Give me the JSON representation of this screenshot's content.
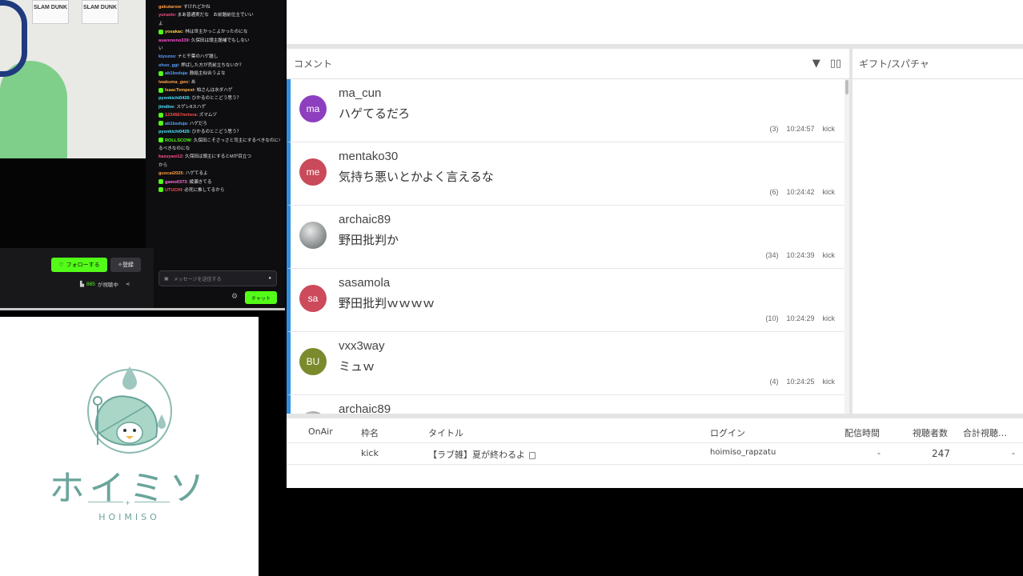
{
  "stream_capture": {
    "posters": [
      "SLAM DUNK",
      "SLAM DUNK"
    ],
    "kick_chat": [
      {
        "user": "gakutarow",
        "text": "すけれどかね",
        "color": "#ff9f43",
        "badge": false
      },
      {
        "user": "yuruolo",
        "text": "まあ普通実だな　お前題前位主でいい",
        "color": "#ff4f8a",
        "badge": false
      },
      {
        "user": "",
        "text": "よ",
        "color": "#e6e6e6",
        "badge": false
      },
      {
        "user": "yosakac",
        "text": "林は世主かっこよかったのにな",
        "color": "#ffd23f",
        "badge": true
      },
      {
        "user": "asarenono339",
        "text": "久保田は頭主題補でもしない",
        "color": "#ff4fd8",
        "badge": false
      },
      {
        "user": "",
        "text": "い",
        "color": "#e6e6e6",
        "badge": false
      },
      {
        "user": "kiyozno",
        "text": "ナと千葉のハゲ題し",
        "color": "#5aa0ff",
        "badge": false
      },
      {
        "user": "ohso_ggi",
        "text": "押ばした方が売前立ちないか？",
        "color": "#5aa0ff",
        "badge": false
      },
      {
        "user": "ab1bsduja",
        "text": "鼓給主似合うよな",
        "color": "#5aa0ff",
        "badge": true
      },
      {
        "user": "iwakuma_gwc",
        "text": "あ",
        "color": "#ff9f43",
        "badge": false
      },
      {
        "user": "IsaacTempest",
        "text": "柏さんは水ダハゲ",
        "color": "#ffb53f",
        "badge": true
      },
      {
        "user": "pyonkichi0426",
        "text": "ひかるのとこどう思う？",
        "color": "#4fe3ff",
        "badge": false
      },
      {
        "user": "jimdive",
        "text": "スゲレ8スハゲ",
        "color": "#4fe3ff",
        "badge": false
      },
      {
        "user": "1234567mrtora",
        "text": "ズマムヅ",
        "color": "#ff4f4f",
        "badge": true
      },
      {
        "user": "ab1bsduja",
        "text": "ハゲだろ",
        "color": "#5aa0ff",
        "badge": true
      },
      {
        "user": "pyonkichi0426",
        "text": "ひかるのとこどう思う？",
        "color": "#4fe3ff",
        "badge": false
      },
      {
        "user": "ROLLSCOW",
        "text": "久保田こそさっさと司主にするべきなのにな",
        "color": "#53fc18",
        "badge": true
      },
      {
        "user": "",
        "text": "るべきなのにな",
        "color": "#e6e6e6",
        "badge": false
      },
      {
        "user": "kazuyaoi12",
        "text": "久保田は頭主にするとMが目立つ",
        "color": "#ff4f8a",
        "badge": false
      },
      {
        "user": "",
        "text": "から",
        "color": "#e6e6e6",
        "badge": false
      },
      {
        "user": "guocai2025",
        "text": "ハゲてるよ",
        "color": "#ff9f43",
        "badge": false
      },
      {
        "user": "gamo0373",
        "text": "綾瀬きてる",
        "color": "#ff6fd8",
        "badge": true
      },
      {
        "user": "UTUCHI",
        "text": "必死に推してるから",
        "color": "#ff4f4f",
        "badge": true
      }
    ],
    "follow_label": "フォローする",
    "subscribe_label": "登録",
    "viewer_count": "885",
    "viewer_suffix": "が視聴中",
    "chat_placeholder": "メッセージを送信する",
    "chat_send_label": "チャット"
  },
  "logo": {
    "text": "ホイミソ",
    "subtext": "HOIMISO"
  },
  "comment_panel": {
    "title": "コメント",
    "items": [
      {
        "user": "ma_cun",
        "initials": "ma",
        "avatar_color": "#8e3fbf",
        "text": "ハゲてるだろ",
        "count": "(3)",
        "time": "10:24:57",
        "platform": "kick"
      },
      {
        "user": "mentako30",
        "initials": "me",
        "avatar_color": "#c94a5a",
        "text": "気持ち悪いとかよく言えるな",
        "count": "(6)",
        "time": "10:24:42",
        "platform": "kick"
      },
      {
        "user": "archaic89",
        "initials": "",
        "avatar_color": "#9aa0a0",
        "text": "野田批判か",
        "count": "(34)",
        "time": "10:24:39",
        "platform": "kick"
      },
      {
        "user": "sasamola",
        "initials": "sa",
        "avatar_color": "#cc4a5c",
        "text": "野田批判ｗｗｗｗ",
        "count": "(10)",
        "time": "10:24:29",
        "platform": "kick"
      },
      {
        "user": "vxx3way",
        "initials": "BU",
        "avatar_color": "#7a8a2c",
        "text": "ミュｗ",
        "count": "(4)",
        "time": "10:24:25",
        "platform": "kick"
      },
      {
        "user": "archaic89",
        "initials": "",
        "avatar_color": "#9aa0a0",
        "text": "",
        "count": "",
        "time": "",
        "platform": ""
      }
    ]
  },
  "gift_panel": {
    "title": "ギフト/スパチャ"
  },
  "stream_table": {
    "headers": [
      "OnAir",
      "枠名",
      "タイトル",
      "ログイン",
      "配信時間",
      "視聴者数",
      "合計視聴…"
    ],
    "rows": [
      {
        "onair": "",
        "name": "kick",
        "title": "【ラブ雑】夏が終わるよ",
        "login": "hoimiso_rapzatu",
        "duration": "-",
        "viewers": "247",
        "total": "-"
      }
    ]
  }
}
